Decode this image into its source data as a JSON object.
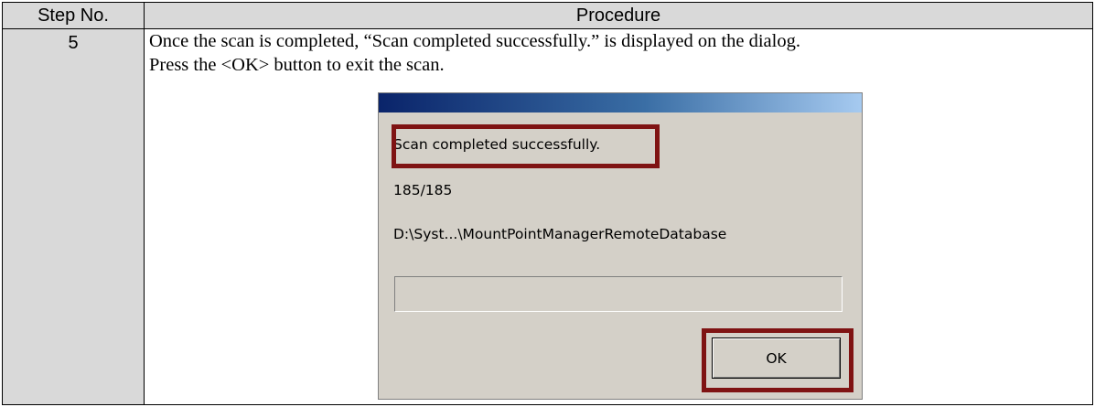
{
  "table": {
    "header_step": "Step No.",
    "header_procedure": "Procedure",
    "step_number": "5",
    "procedure_line1": "Once the scan is completed, “Scan completed successfully.” is displayed on the dialog.",
    "procedure_line2": "Press the <OK> button to exit the scan."
  },
  "dialog": {
    "message": "Scan completed successfully.",
    "count": "185/185",
    "path": "D:\\Syst...\\MountPointManagerRemoteDatabase",
    "progress_percent": 0,
    "ok_label": "OK",
    "highlight_color": "#7f1313"
  }
}
